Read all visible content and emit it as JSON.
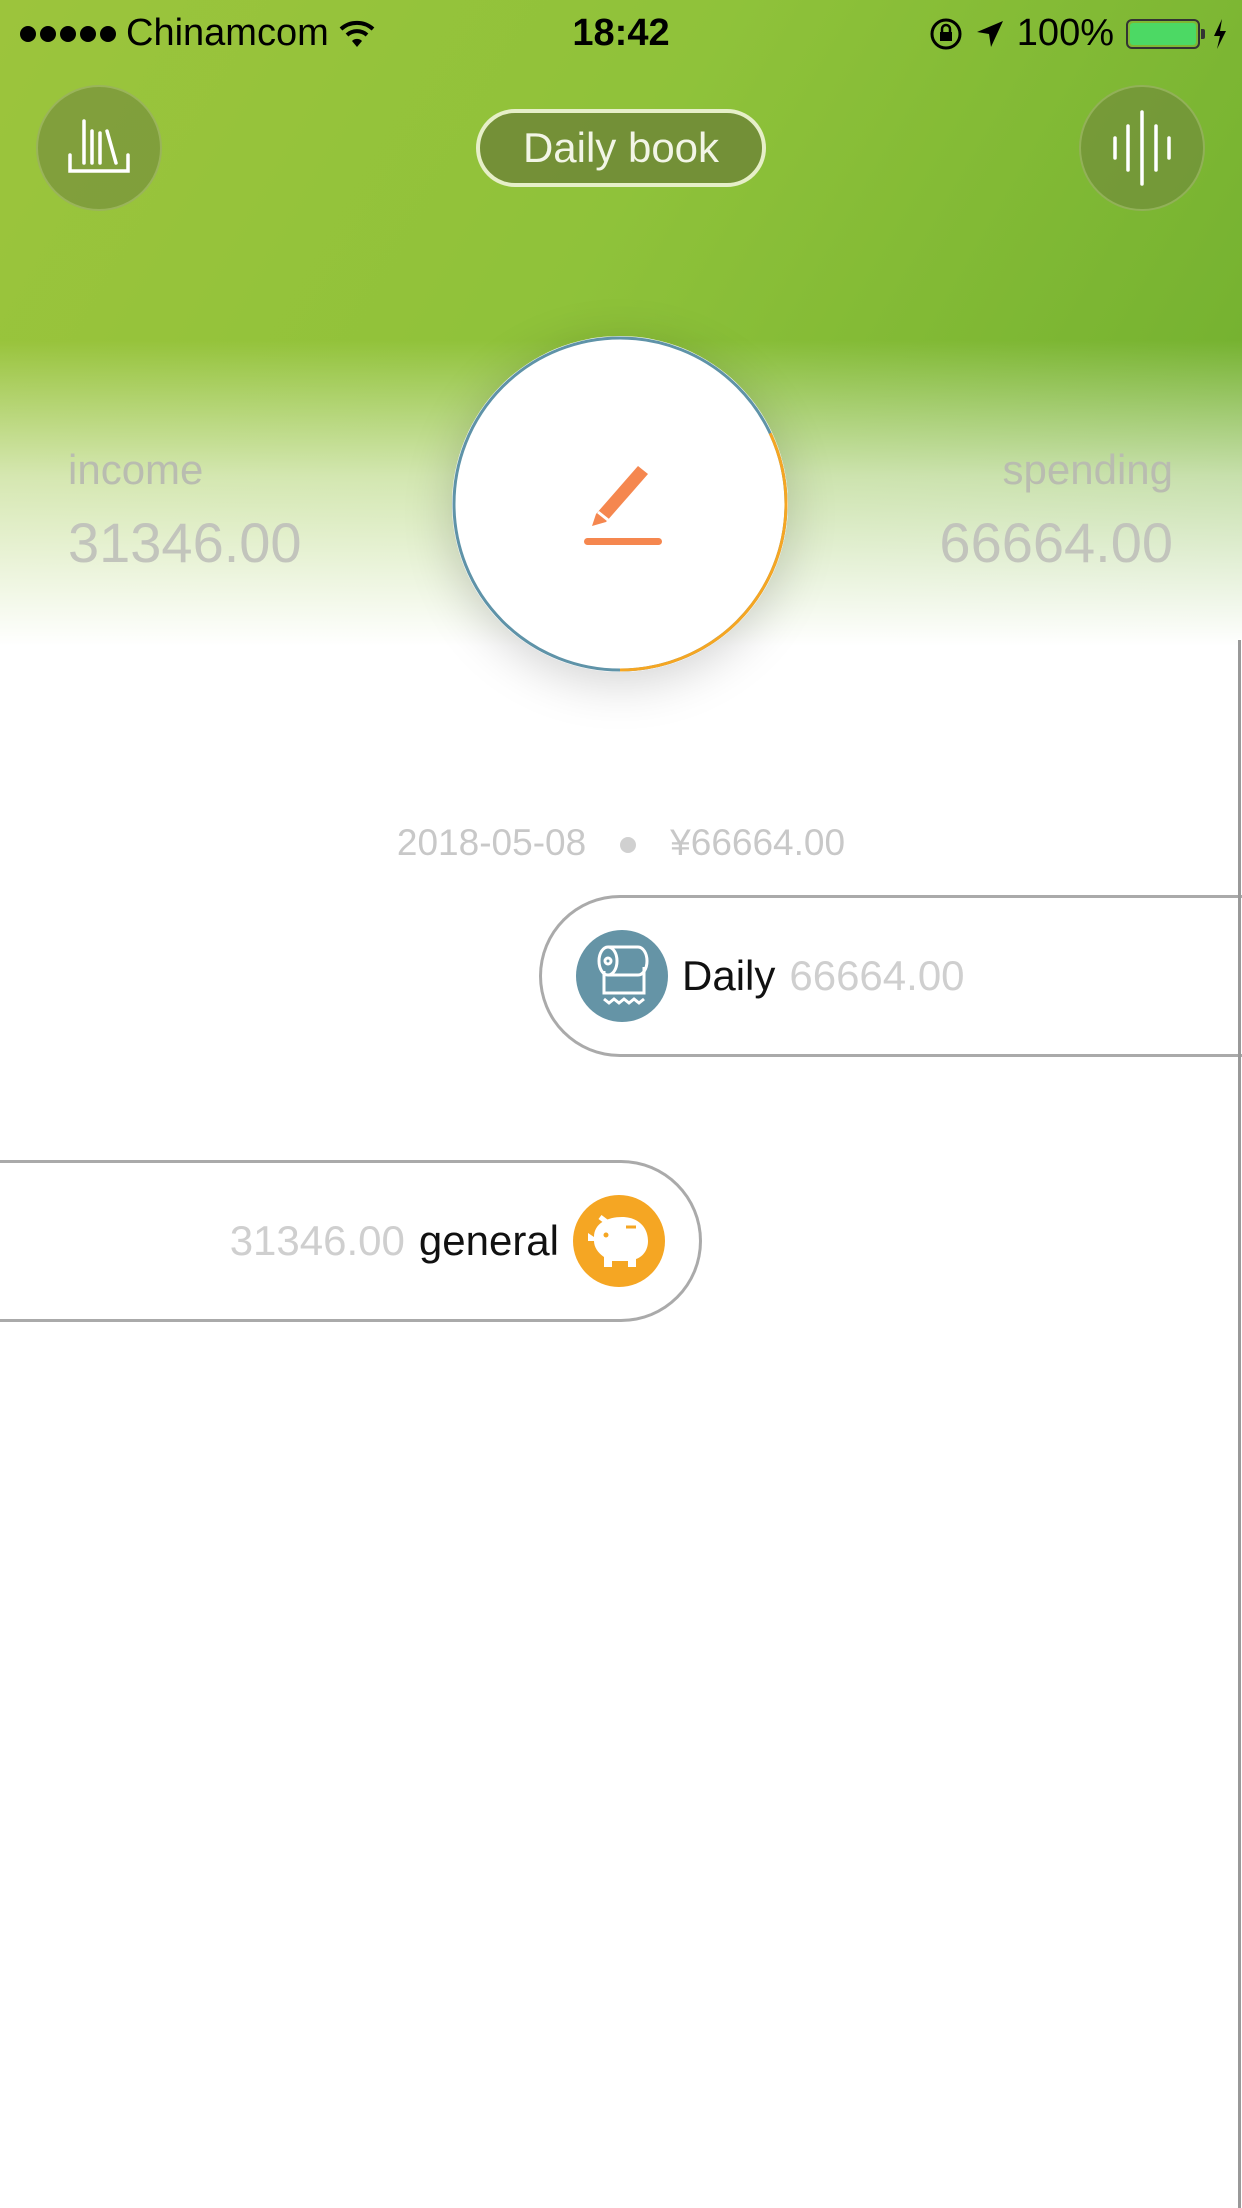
{
  "status_bar": {
    "carrier": "Chinamcom",
    "time": "18:42",
    "battery": "100%",
    "battery_level": 1.0
  },
  "header": {
    "book_title": "Daily book",
    "left_button_icon": "bookshelf-icon",
    "right_button_icon": "voice-wave-icon"
  },
  "summary": {
    "income_label": "income",
    "income_value": "31346.00",
    "spending_label": "spending",
    "spending_value": "66664.00",
    "center_icon": "pencil-edit-icon",
    "ring": {
      "income_share": 0.32,
      "income_color": "#f5a623",
      "spending_color": "#5f93a8"
    }
  },
  "day": {
    "date": "2018-05-08",
    "total": "¥66664.00"
  },
  "entries": [
    {
      "side": "spending",
      "category": "Daily",
      "amount": "66664.00",
      "icon": "toilet-paper-icon",
      "color": "#6594a6"
    },
    {
      "side": "income",
      "category": "general",
      "amount": "31346.00",
      "icon": "piggy-bank-icon",
      "color": "#f5a623"
    }
  ]
}
